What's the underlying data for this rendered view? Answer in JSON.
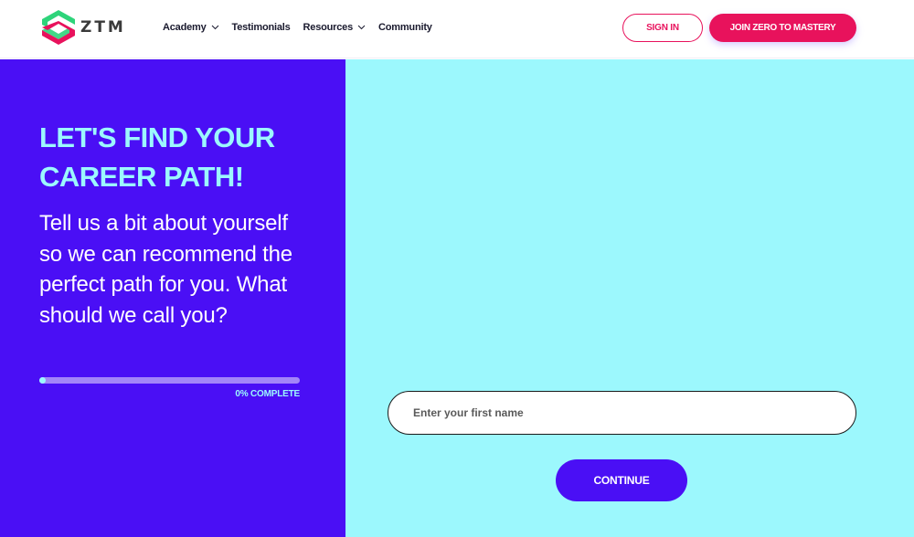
{
  "header": {
    "logo_text": "ZTM",
    "nav": [
      {
        "label": "Academy",
        "has_dropdown": true
      },
      {
        "label": "Testimonials",
        "has_dropdown": false
      },
      {
        "label": "Resources",
        "has_dropdown": true
      },
      {
        "label": "Community",
        "has_dropdown": false
      }
    ],
    "sign_in_label": "SIGN IN",
    "join_label": "JOIN ZERO TO MASTERY"
  },
  "left": {
    "heading_line1": "LET'S FIND YOUR",
    "heading_line2": "CAREER PATH!",
    "subtext": "Tell us a bit about yourself so we can recommend the perfect path for you. What should we call you?",
    "progress_percent": 0,
    "progress_label": "0% COMPLETE"
  },
  "form": {
    "first_name_value": "",
    "first_name_placeholder": "Enter your first name",
    "continue_label": "CONTINUE"
  },
  "colors": {
    "brand_pink": "#e8125c",
    "brand_purple": "#4a0ff5",
    "brand_cyan": "#9cf8fd",
    "logo_green": "#2ed47a"
  }
}
